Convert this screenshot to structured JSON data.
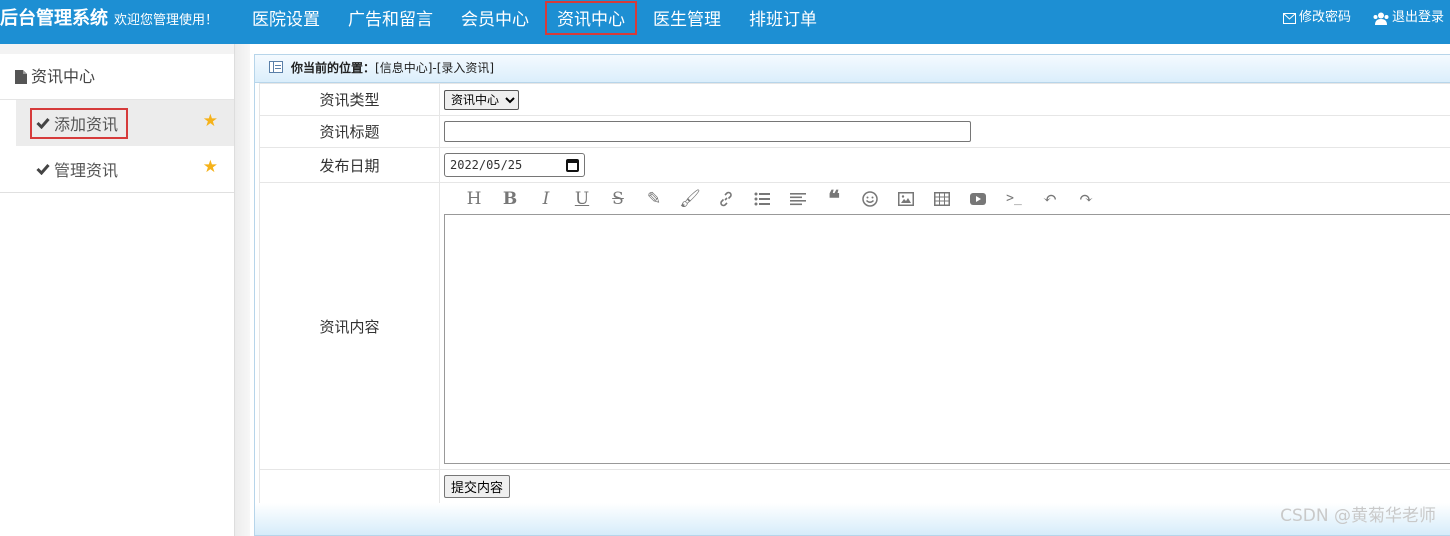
{
  "header": {
    "brand_title": "后台管理系统",
    "welcome": "欢迎您管理使用！",
    "nav": [
      "医院设置",
      "广告和留言",
      "会员中心",
      "资讯中心",
      "医生管理",
      "排班订单"
    ],
    "active_nav": "资讯中心",
    "change_password": "修改密码",
    "logout": "退出登录"
  },
  "sidebar": {
    "section_title": "资讯中心",
    "items": [
      {
        "label": "添加资讯",
        "active": true
      },
      {
        "label": "管理资讯",
        "active": false
      }
    ]
  },
  "breadcrumb": {
    "prefix": "你当前的位置：",
    "path": "[信息中心]-[录入资讯]"
  },
  "form": {
    "type_label": "资讯类型",
    "type_value": "资讯中心",
    "title_label": "资讯标题",
    "title_value": "",
    "date_label": "发布日期",
    "date_value": "2022/05/25",
    "content_label": "资讯内容",
    "submit_label": "提交内容"
  },
  "editor_toolbar": [
    "heading",
    "bold",
    "italic",
    "underline",
    "strikethrough",
    "highlight",
    "paint-brush",
    "link",
    "bullet-list",
    "align-left",
    "blockquote",
    "emoji",
    "image",
    "table",
    "video",
    "code",
    "undo",
    "redo"
  ],
  "watermark": "CSDN @黄菊华老师",
  "colors": {
    "topbar": "#1d8fd3",
    "highlight_border": "#d63b3b",
    "star": "#f5b21a"
  }
}
